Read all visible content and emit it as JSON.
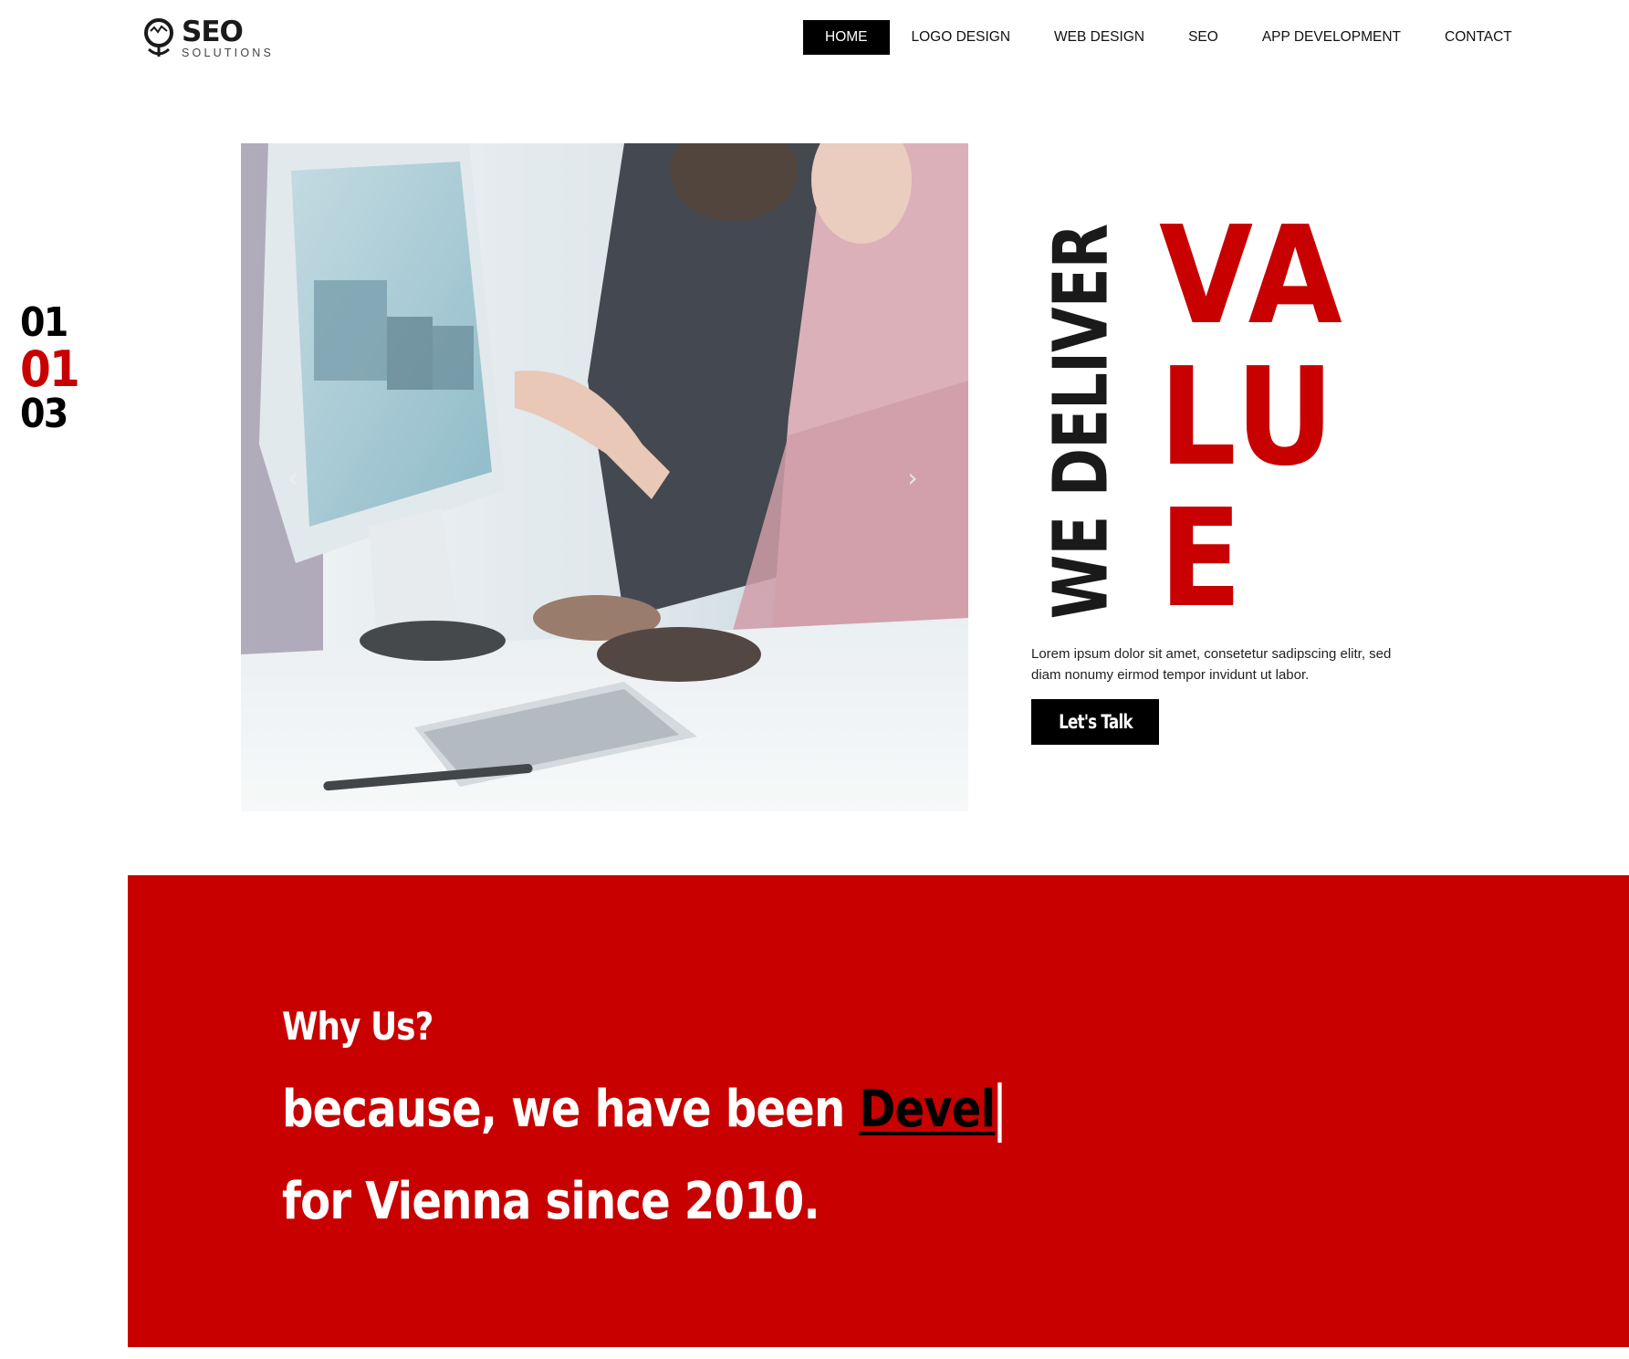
{
  "header": {
    "logo": {
      "title": "SEO",
      "subtitle": "SOLUTIONS"
    },
    "nav": [
      {
        "label": "HOME",
        "active": true
      },
      {
        "label": "LOGO DESIGN",
        "active": false
      },
      {
        "label": "WEB DESIGN",
        "active": false
      },
      {
        "label": "SEO",
        "active": false
      },
      {
        "label": "APP DEVELOPMENT",
        "active": false
      },
      {
        "label": "CONTACT",
        "active": false
      }
    ]
  },
  "slider": {
    "counter": [
      "01",
      "01",
      "03"
    ],
    "prev_icon": "chevron-left-icon",
    "next_icon": "chevron-right-icon"
  },
  "hero": {
    "vertical_text": "WE DELIVER",
    "value_lines": [
      "VA",
      "LU",
      "E"
    ],
    "description": "Lorem ipsum dolor sit amet, consetetur sadipscing elitr, sed diam nonumy eirmod tempor invidunt ut labor.",
    "cta_label": "Let's Talk"
  },
  "why": {
    "heading": "Why Us?",
    "line1_prefix": "because, we have been ",
    "line1_typed": "Devel",
    "line2": "for Vienna since 2010."
  },
  "colors": {
    "accent": "#c80000",
    "dark": "#000000",
    "text": "#1a1a1a",
    "background": "#ffffff"
  }
}
